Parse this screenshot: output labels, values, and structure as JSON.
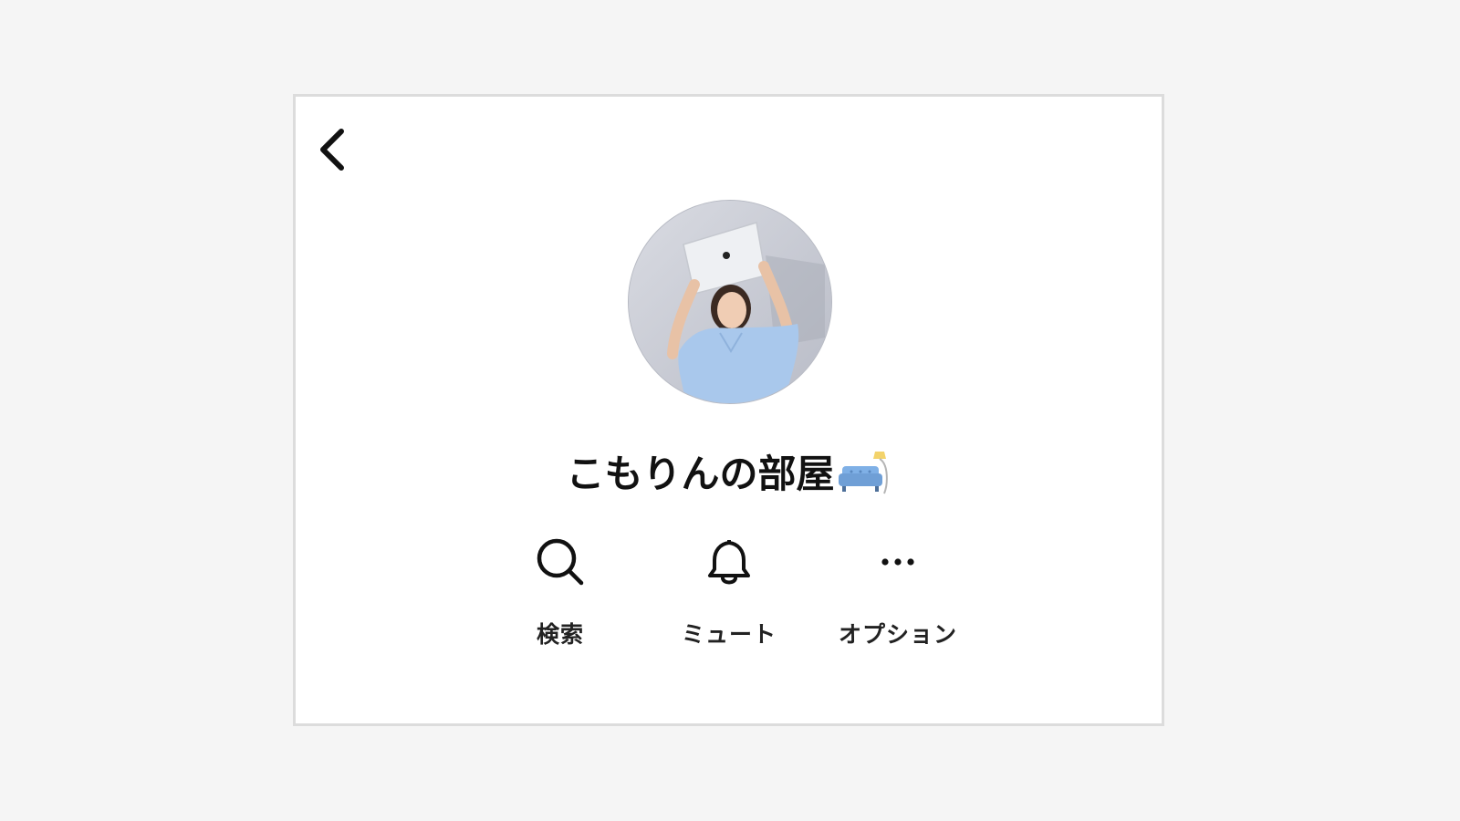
{
  "header": {
    "back_icon": "chevron-left-icon"
  },
  "profile": {
    "avatar_alt": "こもりんの部屋",
    "name": "こもりんの部屋",
    "name_emoji": "couch-and-lamp-emoji"
  },
  "actions": [
    {
      "label": "検索",
      "icon": "search-icon"
    },
    {
      "label": "ミュート",
      "icon": "bell-icon"
    },
    {
      "label": "オプション",
      "icon": "more-dots-icon"
    }
  ],
  "colors": {
    "background": "#f5f5f5",
    "panel": "#ffffff",
    "panel_border": "#dcdcdc",
    "text": "#111111",
    "shirt": "#a9c8ec",
    "sofa": "#6f9fd6"
  }
}
